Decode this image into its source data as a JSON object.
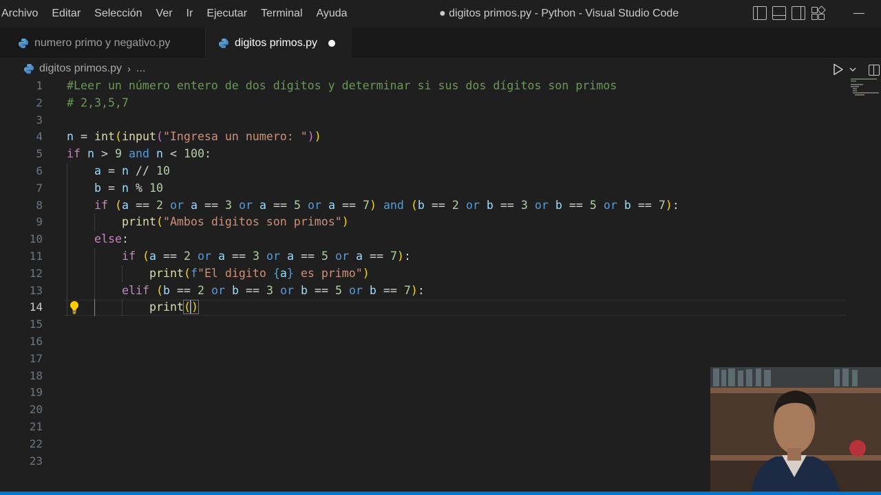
{
  "menu": [
    "Archivo",
    "Editar",
    "Selección",
    "Ver",
    "Ir",
    "Ejecutar",
    "Terminal",
    "Ayuda"
  ],
  "window_title": "● digitos primos.py - Python - Visual Studio Code",
  "tabs": [
    {
      "label": "numero primo y negativo.py",
      "active": false,
      "dirty": false
    },
    {
      "label": "digitos primos.py",
      "active": true,
      "dirty": true
    }
  ],
  "breadcrumb": {
    "file": "digitos primos.py",
    "rest": "..."
  },
  "editor": {
    "current_line": 14,
    "line_numbers": [
      "1",
      "2",
      "3",
      "4",
      "5",
      "6",
      "7",
      "8",
      "9",
      "10",
      "11",
      "12",
      "13",
      "14",
      "15",
      "16",
      "17",
      "18",
      "19",
      "20",
      "21",
      "22",
      "23"
    ],
    "lines": [
      "#Leer un número entero de dos dígitos y determinar si sus dos dígitos son primos",
      "# 2,3,5,7",
      "",
      "n = int(input(\"Ingresa un numero: \"))",
      "if n > 9 and n < 100:",
      "    a = n // 10",
      "    b = n % 10",
      "    if (a == 2 or a == 3 or a == 5 or a == 7) and (b == 2 or b == 3 or b == 5 or b == 7):",
      "        print(\"Ambos digitos son primos\")",
      "    else:",
      "        if (a == 2 or a == 3 or a == 5 or a == 7):",
      "            print(f\"El digito {a} es primo\")",
      "        elif (b == 2 or b == 3 or b == 5 or b == 7):",
      "            print()",
      "",
      "",
      "",
      "",
      "",
      "",
      "",
      "",
      ""
    ]
  },
  "icons": {
    "file_type": "python-file-icon",
    "lightbulb": "lightbulb-icon",
    "run": "run-python-file-icon",
    "split": "split-editor-icon"
  },
  "colors": {
    "accent": "#0078d4",
    "comment": "#6a9955",
    "keyword": "#c586c0",
    "string": "#ce9178",
    "number": "#b5cea8",
    "function": "#dcdcaa",
    "variable": "#9cdcfe",
    "operator_keyword": "#569cd6"
  }
}
